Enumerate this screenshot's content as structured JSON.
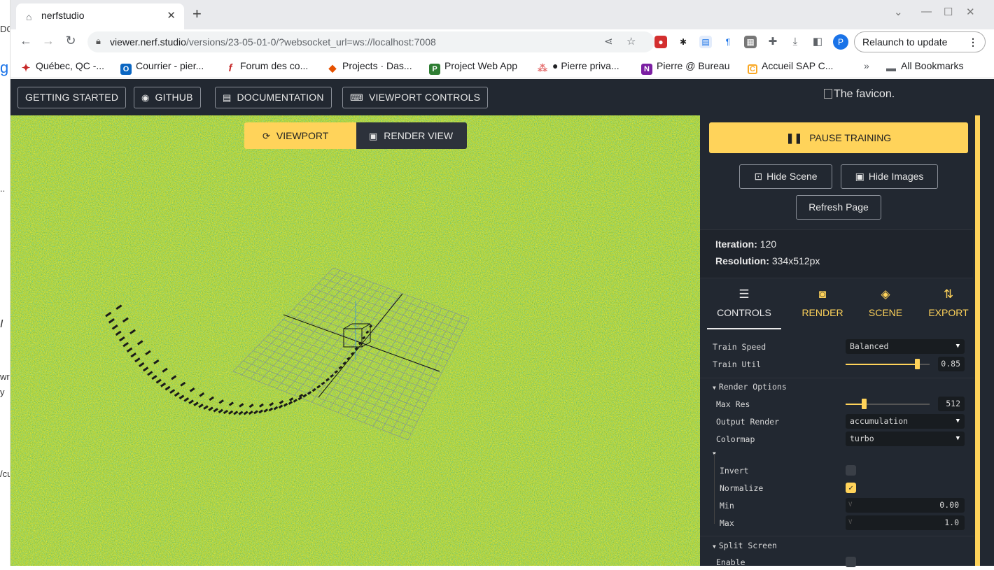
{
  "left_strip": {
    "items": [
      "DC",
      "g",
      "..",
      "I",
      "wrc",
      "y",
      "/cu"
    ]
  },
  "browser": {
    "tab_title": "nerfstudio",
    "url_host": "viewer.nerf.studio",
    "url_path": "/versions/23-05-01-0/?websocket_url=ws://localhost:7008",
    "profile_initial": "P",
    "relaunch_label": "Relaunch to update",
    "bookmarks": [
      {
        "label": "Québec, QC -...",
        "color": "#c62828",
        "icon": "maple-leaf-icon"
      },
      {
        "label": "Courrier - pier...",
        "color": "#0a66c2",
        "icon": "outlook-icon"
      },
      {
        "label": "Forum des co...",
        "color": "#c62828",
        "icon": "f-icon"
      },
      {
        "label": "Projects · Das...",
        "color": "#e65100",
        "icon": "gitlab-icon"
      },
      {
        "label": "Project Web App",
        "color": "#2e7d32",
        "icon": "project-icon"
      },
      {
        "label": "● Pierre priva...",
        "color": "#e57373",
        "icon": "asana-icon"
      },
      {
        "label": "Pierre @ Bureau",
        "color": "#7b1fa2",
        "icon": "onenote-icon"
      },
      {
        "label": "Accueil SAP C...",
        "color": "#f9a825",
        "icon": "sap-icon"
      }
    ],
    "all_bookmarks_label": "All Bookmarks"
  },
  "app": {
    "top_buttons": {
      "getting_started": "GETTING STARTED",
      "github": "GITHUB",
      "documentation": "DOCUMENTATION",
      "viewport_controls": "VIEWPORT CONTROLS"
    },
    "favicon_alt": "The favicon.",
    "view_tabs": {
      "viewport": "VIEWPORT",
      "render_view": "RENDER VIEW",
      "active": "VIEWPORT"
    },
    "panel": {
      "pause_training": "PAUSE TRAINING",
      "hide_scene": "Hide Scene",
      "hide_images": "Hide Images",
      "refresh_page": "Refresh Page",
      "iteration_label": "Iteration:",
      "iteration_value": "120",
      "resolution_label": "Resolution:",
      "resolution_value": "334x512px",
      "tabs": [
        "CONTROLS",
        "RENDER",
        "SCENE",
        "EXPORT"
      ],
      "active_tab": "CONTROLS",
      "controls": {
        "train_speed_label": "Train Speed",
        "train_speed_value": "Balanced",
        "train_util_label": "Train Util",
        "train_util_value": "0.85",
        "train_util_fraction": 0.85,
        "render_options_label": "Render Options",
        "max_res_label": "Max Res",
        "max_res_value": "512",
        "max_res_fraction": 0.22,
        "output_render_label": "Output Render",
        "output_render_value": "accumulation",
        "colormap_label": "Colormap",
        "colormap_value": "turbo",
        "invert_label": "Invert",
        "invert_checked": false,
        "normalize_label": "Normalize",
        "normalize_checked": true,
        "min_label": "Min",
        "min_value": "0.00",
        "max_label": "Max",
        "max_value": "1.0",
        "split_screen_label": "Split Screen",
        "enable_label": "Enable"
      }
    }
  },
  "colors": {
    "accent": "#ffd35a",
    "background": "#222831"
  }
}
